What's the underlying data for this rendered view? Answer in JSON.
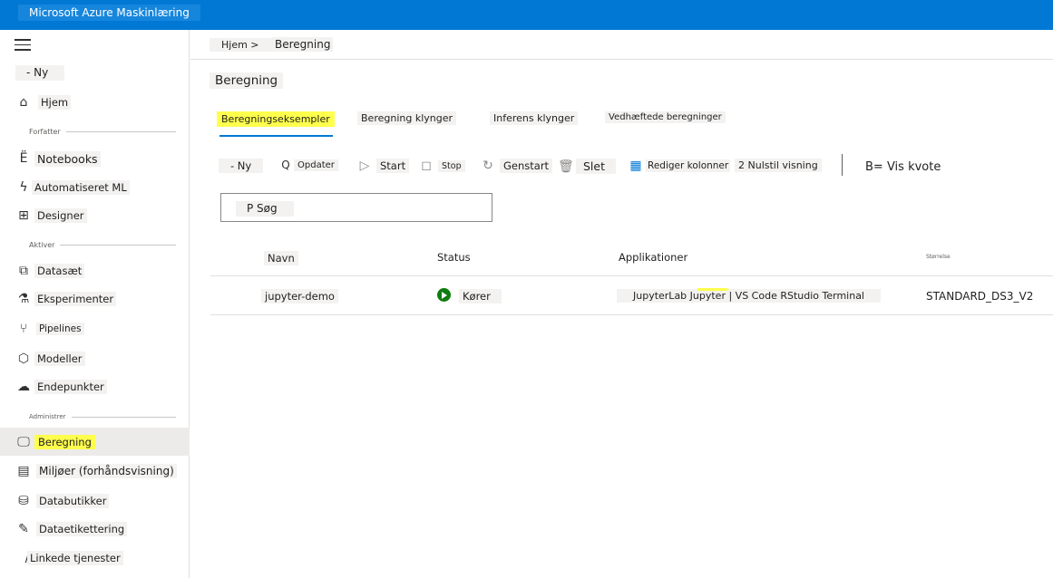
{
  "app": {
    "title": "Microsoft Azure Maskinlæring"
  },
  "sidebar": {
    "new_label": "- Ny",
    "home": "Hjem",
    "sections": {
      "author": "Forfatter",
      "assets": "Aktiver",
      "manage": "Administrer"
    },
    "author_items": [
      "Notebooks",
      "Automatiseret ML",
      "Designer"
    ],
    "asset_items": [
      "Datasæt",
      "Eksperimenter",
      "Pipelines",
      "Modeller",
      "Endepunkter"
    ],
    "manage_items": [
      "Beregning",
      "Miljøer (forhåndsvisning)",
      "Databutikker",
      "Dataetikettering",
      "Linkede tjenester"
    ],
    "active_item": "Beregning"
  },
  "breadcrumb": {
    "home": "Hjem >",
    "current": "Beregning"
  },
  "page": {
    "title": "Beregning"
  },
  "tabs": [
    "Beregningseksempler",
    "Beregning klynger",
    "Inferens klynger",
    "Vedhæftede beregninger"
  ],
  "toolbar": {
    "new": "- Ny",
    "refresh": "Opdater",
    "start": "Start",
    "stop": "Stop",
    "restart": "Genstart",
    "delete": "Slet",
    "edit_columns": "Rediger kolonner",
    "reset_view": "2 Nulstil visning",
    "view_quota": "B= Vis kvote"
  },
  "search": {
    "label": "P Søg"
  },
  "table": {
    "headers": {
      "name": "Navn",
      "status": "Status",
      "apps": "Applikationer",
      "size": "Størrelse"
    },
    "rows": [
      {
        "name": "jupyter-demo",
        "status": "Kører",
        "apps": "JupyterLab Jupyter | VS Code RStudio Terminal",
        "size": "STANDARD_DS3_V2"
      }
    ]
  },
  "colors": {
    "accent": "#0078d4",
    "highlight": "#ffff4d",
    "running": "#107c10"
  }
}
